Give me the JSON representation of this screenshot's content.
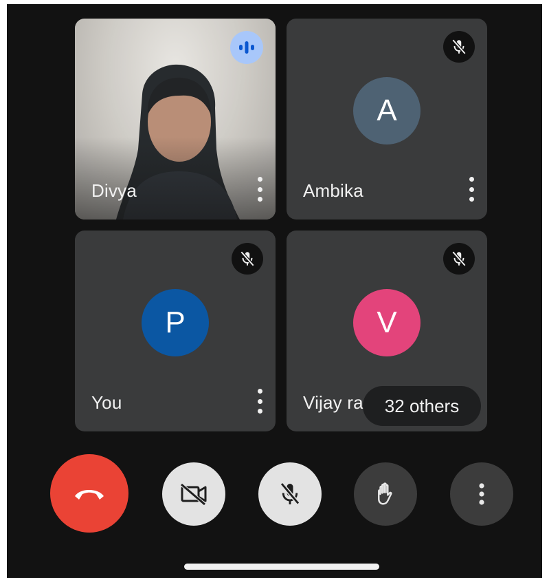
{
  "participants": [
    {
      "name": "Divya",
      "type": "video",
      "state": "speaking",
      "indicator_icon": "audio-wave-icon"
    },
    {
      "name": "Ambika",
      "type": "avatar",
      "initial": "A",
      "avatar_color": "#4e6273",
      "state": "muted",
      "indicator_icon": "mic-off-icon"
    },
    {
      "name": "You",
      "type": "avatar",
      "initial": "P",
      "avatar_color": "#0b57a3",
      "state": "muted",
      "indicator_icon": "mic-off-icon"
    },
    {
      "name": "Vijay ra",
      "type": "avatar",
      "initial": "V",
      "avatar_color": "#e3447b",
      "state": "muted",
      "indicator_icon": "mic-off-icon"
    }
  ],
  "others_label": "32 others",
  "controls": [
    {
      "id": "leave",
      "icon": "hang-up-icon",
      "color": "#ea4335"
    },
    {
      "id": "camera",
      "icon": "camera-off-icon",
      "color": "#e3e3e3"
    },
    {
      "id": "microphone",
      "icon": "mic-off-icon",
      "color": "#e3e3e3"
    },
    {
      "id": "raise-hand",
      "icon": "hand-icon",
      "color": "#3c3c3c"
    },
    {
      "id": "more",
      "icon": "more-vert-icon",
      "color": "#3c3c3c"
    }
  ]
}
